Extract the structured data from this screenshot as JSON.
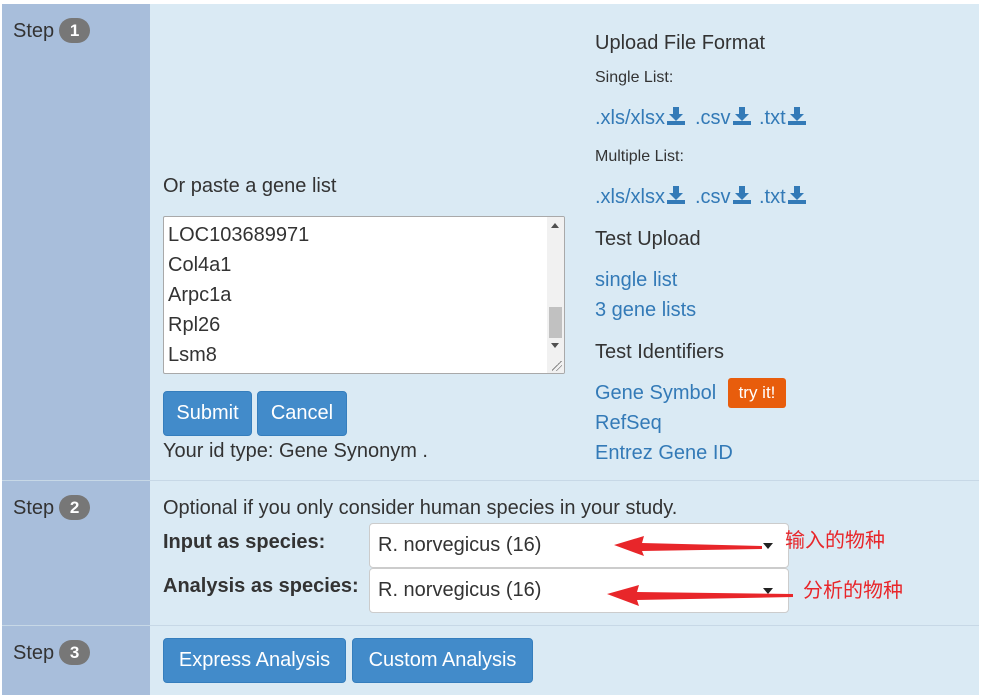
{
  "step": {
    "label": "Step",
    "badges": [
      "1",
      "2",
      "3"
    ]
  },
  "step1": {
    "paste_label": "Or paste a gene list",
    "gene_lines": [
      "LOC103689971",
      "Col4a1",
      "Arpc1a",
      "Rpl26",
      "Lsm8"
    ],
    "submit_label": "Submit",
    "cancel_label": "Cancel",
    "id_type_text": "Your id type: Gene Synonym ."
  },
  "upload": {
    "heading": "Upload File Format",
    "single_list_label": "Single List:",
    "multiple_list_label": "Multiple List:",
    "formats": [
      ".xls/xlsx",
      ".csv",
      ".txt"
    ]
  },
  "test_upload": {
    "heading": "Test Upload",
    "links": [
      "single list",
      "3 gene lists"
    ]
  },
  "test_identifiers": {
    "heading": "Test Identifiers",
    "links": [
      "Gene Symbol",
      "RefSeq",
      "Entrez Gene ID"
    ],
    "try_badge": "try it!"
  },
  "step2": {
    "optional_text": "Optional if you only consider human species in your study.",
    "input_species_label": "Input as species:",
    "analysis_species_label": "Analysis as species:",
    "input_species_value": "R. norvegicus (16)",
    "analysis_species_value": "R. norvegicus (16)",
    "annotation_input": "输入的物种",
    "annotation_analysis": "分析的物种"
  },
  "step3": {
    "express_label": "Express Analysis",
    "custom_label": "Custom Analysis"
  },
  "colors": {
    "panel_bg": "#daeaf4",
    "step_column_bg": "#a8bedb",
    "button_bg": "#428bca",
    "link": "#337ab7",
    "try_badge_bg": "#e85d0c",
    "annotation_red": "#e8262a"
  },
  "icons": [
    "download-icon",
    "dropdown-caret-icon",
    "annotation-arrow-icon"
  ]
}
